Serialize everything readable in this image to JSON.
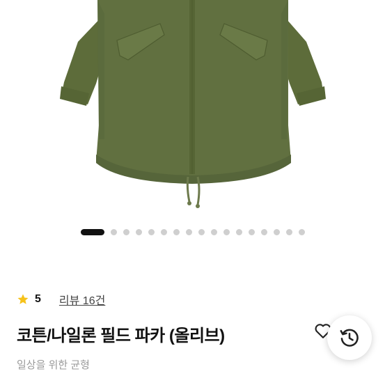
{
  "product": {
    "rating": "5",
    "reviews_label": "리뷰 16건",
    "title": "코튼/나일론 필드 파카 (올리브)",
    "subtitle": "일상을 위한 균형"
  },
  "carousel": {
    "total": 17,
    "active_index": 0
  },
  "icons": {
    "rating": "star-icon",
    "wishlist": "heart-icon",
    "history": "history-icon"
  },
  "colors": {
    "parka": "#5f6e3c",
    "star": "#f6c21a"
  }
}
